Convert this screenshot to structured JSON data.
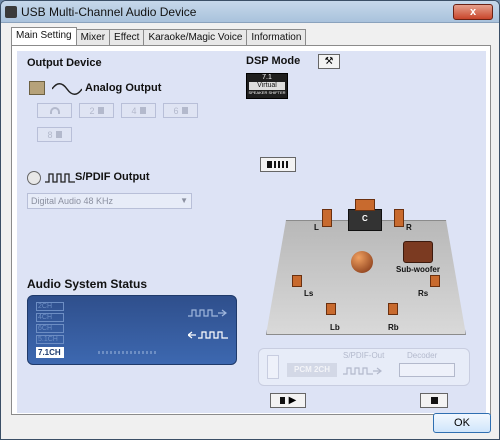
{
  "window": {
    "title": "USB Multi-Channel Audio Device",
    "close_label": "x"
  },
  "tabs": [
    "Main Setting",
    "Mixer",
    "Effect",
    "Karaoke/Magic Voice",
    "Information"
  ],
  "output_device": {
    "title": "Output Device",
    "analog_label": "Analog Output",
    "channel_buttons": [
      "2",
      "4",
      "6",
      "8"
    ],
    "spdif_label": "S/PDIF Output",
    "spdif_select_value": "Digital Audio 48 KHz"
  },
  "audio_status": {
    "title": "Audio System Status",
    "channels": [
      "2CH",
      "4CH",
      "6CH",
      "5.1CH",
      "7.1CH"
    ],
    "active_channel": "7.1CH"
  },
  "dsp": {
    "title": "DSP Mode",
    "badge_top": "7.1",
    "badge_mid": "Virtual",
    "badge_bottom": "SPEAKER SHIFTER"
  },
  "speakers": {
    "L": "L",
    "C": "C",
    "R": "R",
    "Ls": "Ls",
    "Rs": "Rs",
    "Lb": "Lb",
    "Rb": "Rb",
    "sub": "Sub-woofer"
  },
  "decoder_strip": {
    "spdif_out": "S/PDIF-Out",
    "decoder": "Decoder",
    "pcm": "PCM 2CH"
  },
  "footer": {
    "ok_label": "OK"
  },
  "colors": {
    "panel_bg": "#dde3f5",
    "status_bg": "#2f4f8c",
    "active_accent": "#ffffff"
  }
}
